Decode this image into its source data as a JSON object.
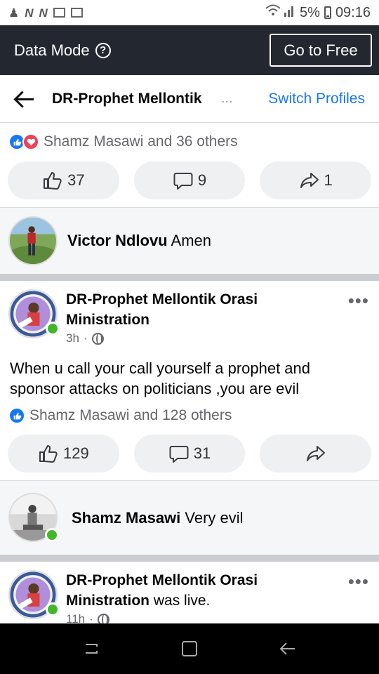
{
  "status_bar": {
    "icons_left": [
      "person-icon",
      "notification-n-icon",
      "notification-n-icon",
      "gmail-icon",
      "image-icon"
    ],
    "signal": "wifi-signal-icon",
    "battery_text": "5%",
    "time": "09:16"
  },
  "data_mode": {
    "label": "Data Mode",
    "help_glyph": "?",
    "button_label": "Go to Free"
  },
  "header": {
    "title": "DR-Prophet Mellontik",
    "ellipsis": "...",
    "switch_label": "Switch Profiles"
  },
  "post1": {
    "reactions_text": "Shamz Masawi and 36 others",
    "like_count": "37",
    "comment_count": "9",
    "share_count": "1"
  },
  "comment1": {
    "author": "Victor Ndlovu",
    "text": "Amen"
  },
  "post2": {
    "author": "DR-Prophet Mellontik Orasi Ministration",
    "time": "3h",
    "separator": "·",
    "body": "When u call your call yourself a prophet and sponsor attacks on politicians ,you are evil",
    "reactions_text": "Shamz Masawi and 128 others",
    "like_count": "129",
    "comment_count": "31"
  },
  "comment2": {
    "author": "Shamz Masawi",
    "text": "Very evil"
  },
  "post3": {
    "author": "DR-Prophet Mellontik Orasi Ministration",
    "suffix": "was live.",
    "time": "11h",
    "separator": "·"
  },
  "colors": {
    "accent": "#1877f2",
    "data_bar": "#232830",
    "online": "#42b72a",
    "love": "#f33e58"
  }
}
